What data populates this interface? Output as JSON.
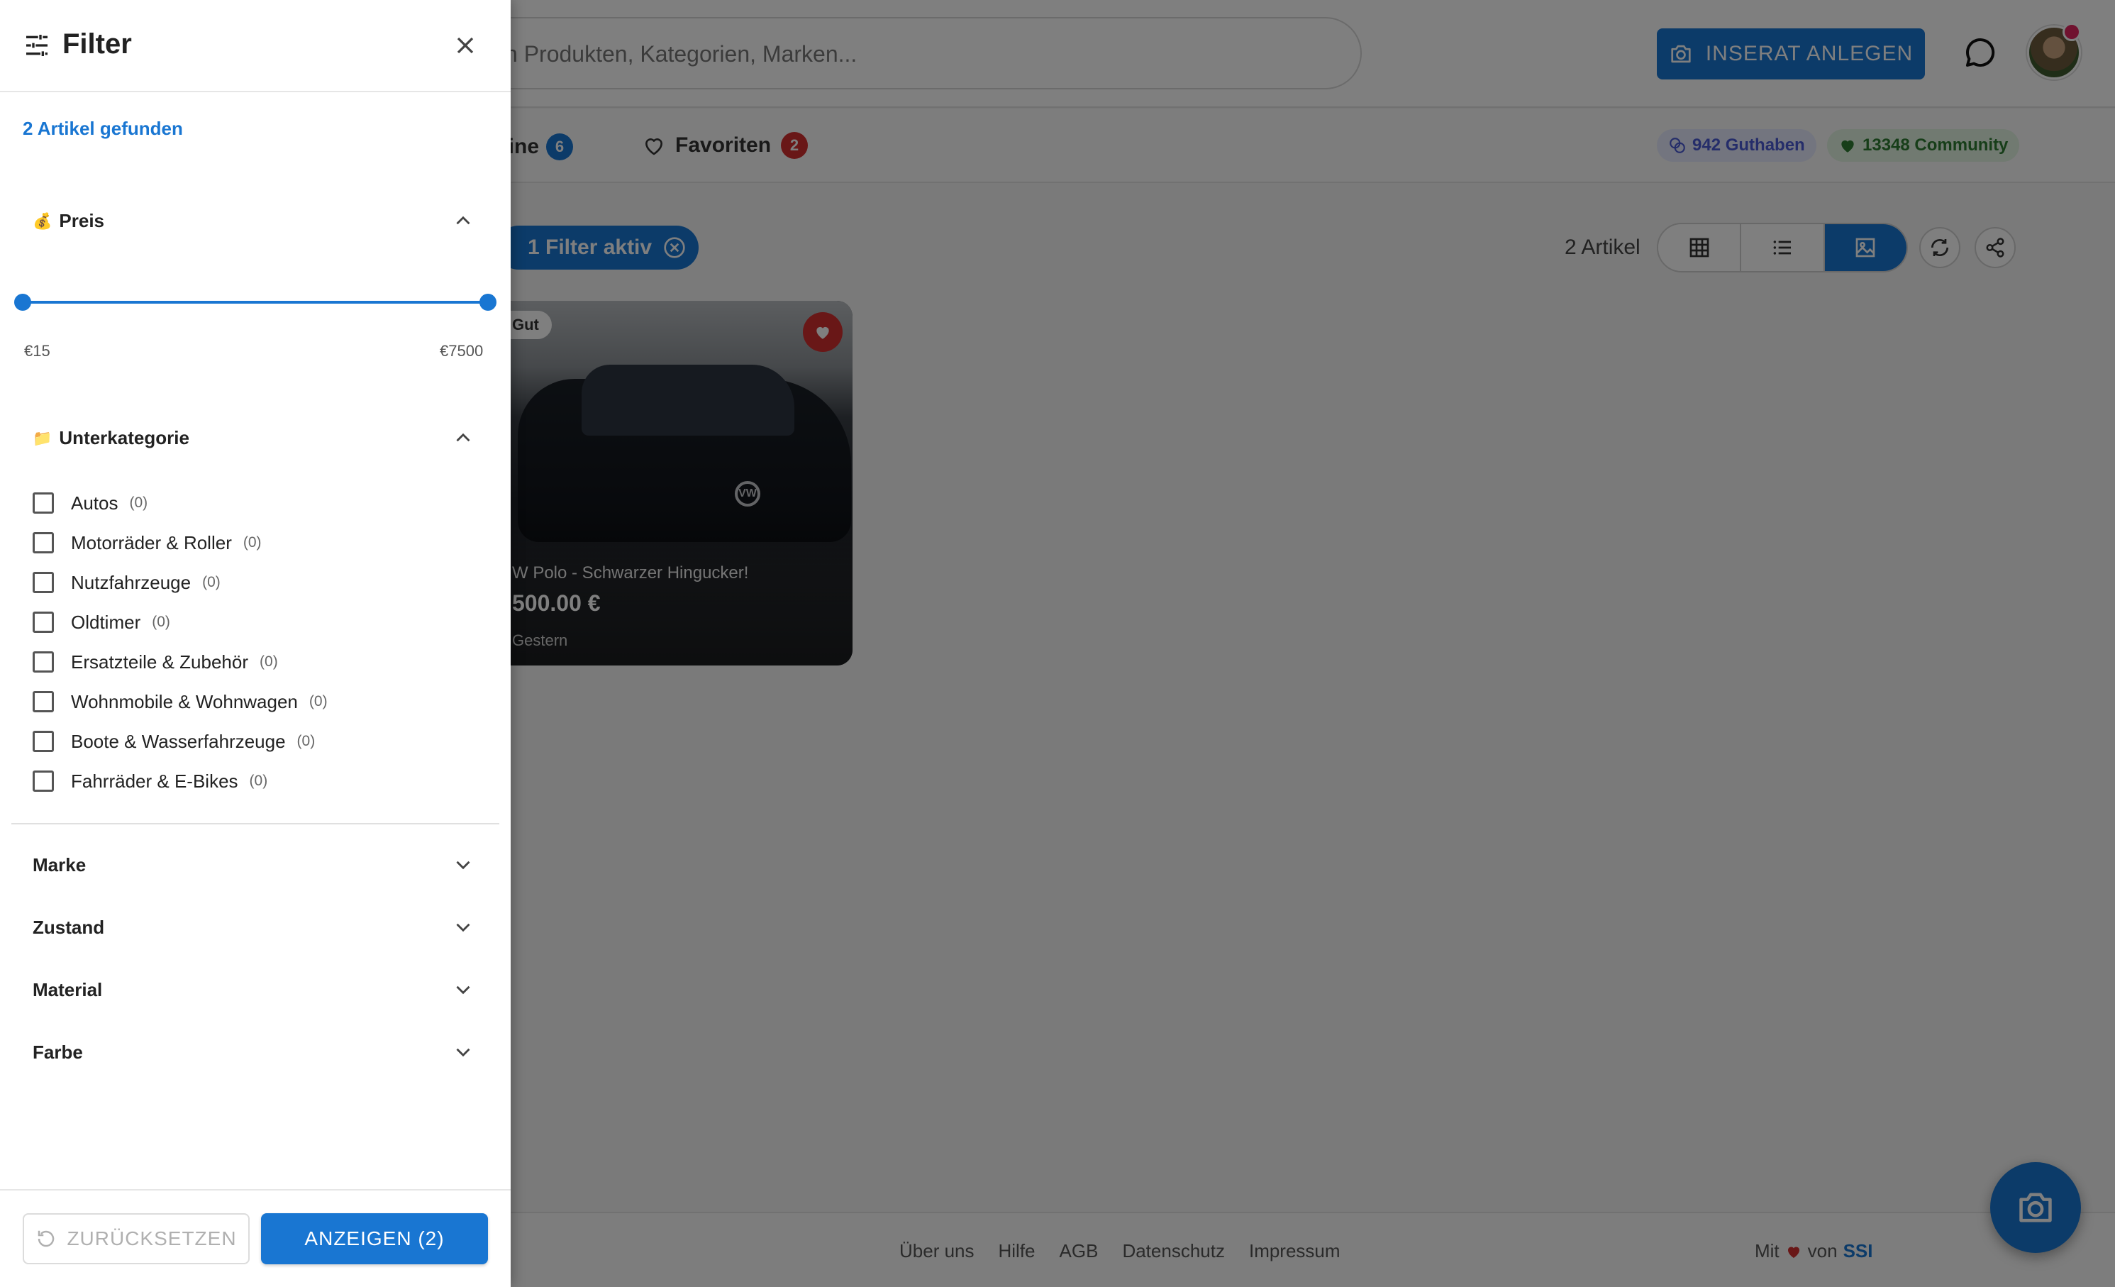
{
  "header": {
    "search_placeholder": "h Produkten, Kategorien, Marken...",
    "inserat_button": "INSERAT ANLEGEN",
    "avatar_icon": "user-avatar"
  },
  "subnav": {
    "meine_label": "eine",
    "meine_count": "6",
    "favoriten_label": "Favoriten",
    "favoriten_count": "2",
    "guthaben": "942 Guthaben",
    "community": "13348 Community"
  },
  "toolbar": {
    "filter_chip": "1 Filter aktiv",
    "artikel_count": "2 Artikel"
  },
  "listing": {
    "condition": "Gut",
    "title": "W Polo - Schwarzer Hingucker!",
    "price": "500.00 €",
    "date": "Gestern",
    "logo_text": "VW"
  },
  "footer": {
    "links": [
      "Über uns",
      "Hilfe",
      "AGB",
      "Datenschutz",
      "Impressum"
    ],
    "credit_prefix": "Mit",
    "credit_mid": "von",
    "credit_brand": "SSI"
  },
  "drawer": {
    "title": "Filter",
    "found": "2 Artikel gefunden",
    "price_section": {
      "icon": "💰",
      "title": "Preis",
      "min_label": "€15",
      "max_label": "€7500",
      "min": 15,
      "max": 7500,
      "range_low_fraction": 0.0,
      "range_high_fraction": 1.0
    },
    "subcat_section": {
      "icon": "📁",
      "title": "Unterkategorie",
      "items": [
        {
          "label": "Autos",
          "count": "(0)"
        },
        {
          "label": "Motorräder & Roller",
          "count": "(0)"
        },
        {
          "label": "Nutzfahrzeuge",
          "count": "(0)"
        },
        {
          "label": "Oldtimer",
          "count": "(0)"
        },
        {
          "label": "Ersatzteile & Zubehör",
          "count": "(0)"
        },
        {
          "label": "Wohnmobile & Wohnwagen",
          "count": "(0)"
        },
        {
          "label": "Boote & Wasserfahrzeuge",
          "count": "(0)"
        },
        {
          "label": "Fahrräder & E-Bikes",
          "count": "(0)"
        }
      ]
    },
    "collapsed_sections": [
      "Marke",
      "Zustand",
      "Material",
      "Farbe"
    ],
    "reset_button": "ZURÜCKSETZEN",
    "show_button": "ANZEIGEN (2)"
  },
  "colors": {
    "accent": "#1976d2",
    "favorite_badge": "#d32f2f",
    "guthaben": "#4a5bd4",
    "community": "#2e7d32"
  }
}
